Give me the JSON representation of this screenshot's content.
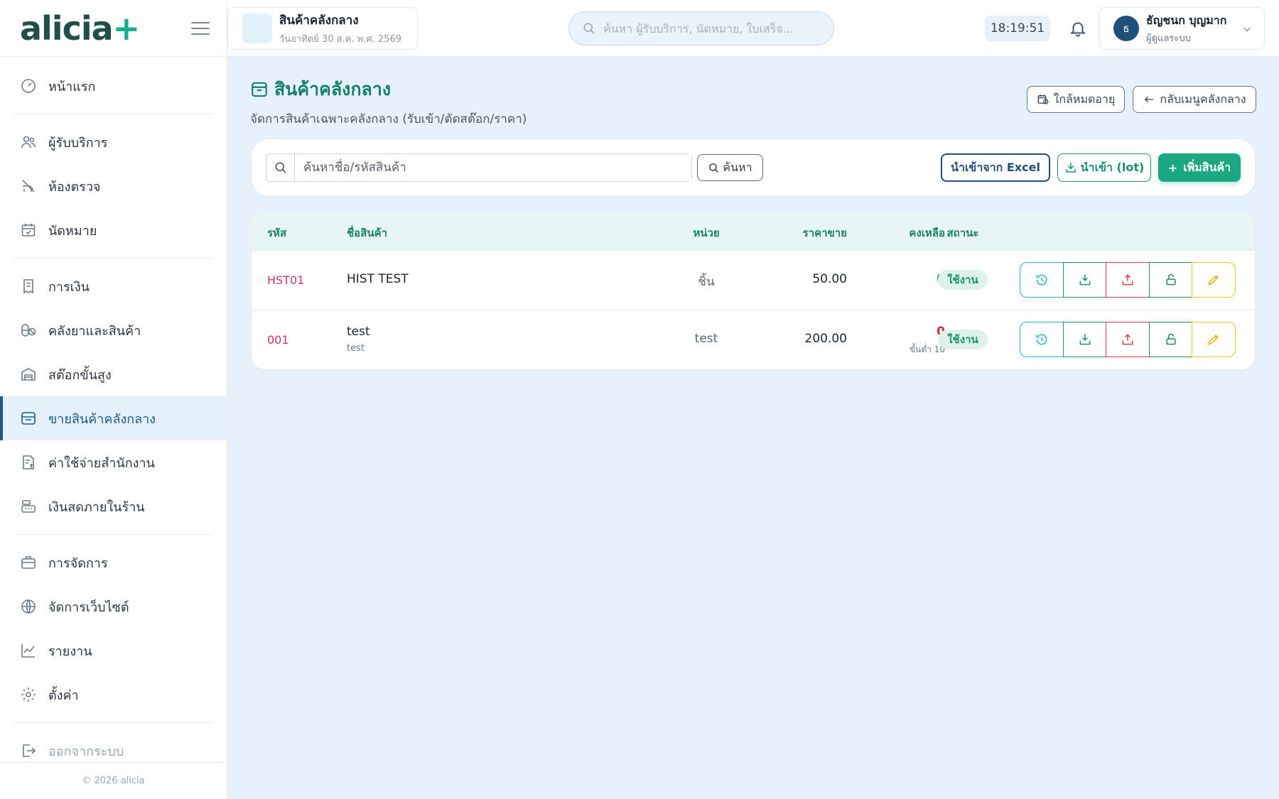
{
  "sidebar": {
    "logo_main": "alicia",
    "logo_plus": "+",
    "items": [
      {
        "label": "หน้าแรก",
        "icon": "dashboard-icon"
      },
      {
        "label": "ผู้รับบริการ",
        "icon": "users-icon"
      },
      {
        "label": "ห้องตรวจ",
        "icon": "exam-room-icon"
      },
      {
        "label": "นัดหมาย",
        "icon": "calendar-check-icon"
      },
      {
        "label": "การเงิน",
        "icon": "receipt-icon"
      },
      {
        "label": "คลังยาและสินค้า",
        "icon": "pills-icon"
      },
      {
        "label": "สต๊อกขั้นสูง",
        "icon": "warehouse-icon"
      },
      {
        "label": "ขายสินค้าคลังกลาง",
        "icon": "store-icon",
        "active": true
      },
      {
        "label": "ค่าใช้จ่ายสำนักงาน",
        "icon": "expense-icon"
      },
      {
        "label": "เงินสดภายในร้าน",
        "icon": "cash-register-icon"
      },
      {
        "label": "การจัดการ",
        "icon": "briefcase-icon"
      },
      {
        "label": "จัดการเว็บไซต์",
        "icon": "globe-icon"
      },
      {
        "label": "รายงาน",
        "icon": "chart-icon"
      },
      {
        "label": "ตั้งค่า",
        "icon": "gear-icon"
      },
      {
        "label": "ออกจากระบบ",
        "icon": "logout-icon"
      }
    ],
    "footer": "© 2026 alicia"
  },
  "topbar": {
    "shop_name": "สินค้าคลังกลาง",
    "shop_date": "วันอาทิตย์ 30 ส.ค. พ.ศ. 2569",
    "search_placeholder": "ค้นหา ผู้รับบริการ, นัดหมาย, ใบเสร็จ...",
    "clock": "18:19:51",
    "user_initial": "ธ",
    "user_name": "ธัญชนก บุญมาก",
    "user_role": "ผู้ดูแลระบบ"
  },
  "page": {
    "title": "สินค้าคลังกลาง",
    "subtitle": "จัดการสินค้าเฉพาะคลังกลาง (รับเข้า/ตัดสต๊อก/ราคา)",
    "btn_expiring": "ใกล้หมดอายุ",
    "btn_back": "กลับเมนูคลังกลาง"
  },
  "toolbar": {
    "search_placeholder": "ค้นหาชื่อ/รหัสสินค้า",
    "find_label": "ค้นหา",
    "excel_label": "นำเข้าจาก Excel",
    "lot_label": "นำเข้า (lot)",
    "add_label": "เพิ่มสินค้า"
  },
  "table": {
    "headers": {
      "code": "รหัส",
      "name": "ชื่อสินค้า",
      "unit": "หน่วย",
      "price": "ราคาขาย",
      "stock": "คงเหลือ",
      "status": "สถานะ"
    },
    "rows": [
      {
        "code": "HST01",
        "name": "HIST TEST",
        "name_sub": "",
        "unit": "ชิ้น",
        "price": "50.00",
        "stock": "0",
        "min": "",
        "status": "ใช้งาน"
      },
      {
        "code": "001",
        "name": "test",
        "name_sub": "test",
        "unit": "test",
        "price": "200.00",
        "stock": "0",
        "min": "ขั้นต่ำ 10",
        "status": "ใช้งาน"
      }
    ]
  },
  "colors": {
    "brand_dark": "#1f4f47",
    "brand_green": "#17b08a",
    "accent_green": "#14826b",
    "navy": "#1f4f7a",
    "code_pink": "#d1336b",
    "alert_red": "#d12a3a",
    "page_bg": "#e6f1fb"
  }
}
